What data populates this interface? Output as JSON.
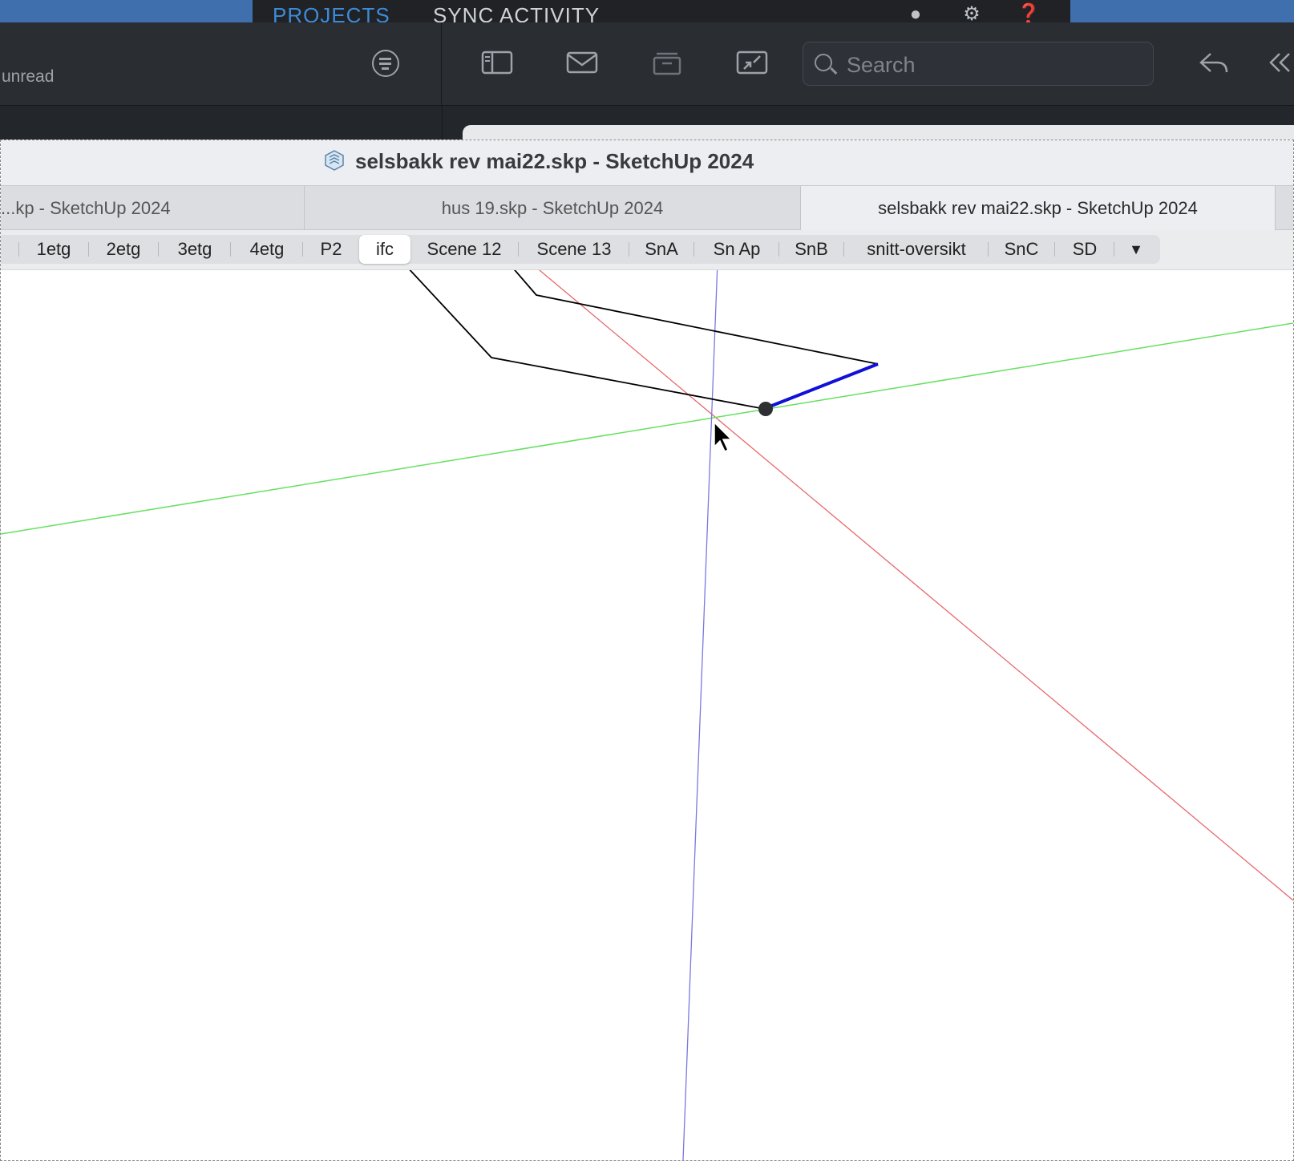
{
  "background_app": {
    "tabs": [
      "PROJECTS",
      "SYNC ACTIVITY"
    ],
    "icons": [
      "user-icon",
      "gear-icon",
      "help-icon"
    ],
    "accent": "#3d8bd8"
  },
  "mail": {
    "unread_label": "unread",
    "search_placeholder": "Search",
    "toolbar_icons": [
      "filter-icon",
      "sidebar-icon",
      "envelope-icon",
      "archive-icon",
      "collapse-icon",
      "reply-icon",
      "back-double-icon"
    ]
  },
  "sketchup": {
    "window_title": "selsbakk rev mai22.skp - SketchUp 2024",
    "doc_tabs": [
      {
        "label": "...kp - SketchUp 2024",
        "active": false
      },
      {
        "label": "hus 19.skp - SketchUp 2024",
        "active": false
      },
      {
        "label": "selsbakk rev mai22.skp - SketchUp 2024",
        "active": true
      }
    ],
    "scenes": [
      {
        "label": "1etg",
        "active": false
      },
      {
        "label": "2etg",
        "active": false
      },
      {
        "label": "3etg",
        "active": false
      },
      {
        "label": "4etg",
        "active": false
      },
      {
        "label": "P2",
        "active": false
      },
      {
        "label": "ifc",
        "active": true
      },
      {
        "label": "Scene 12",
        "active": false
      },
      {
        "label": "Scene 13",
        "active": false
      },
      {
        "label": "SnA",
        "active": false
      },
      {
        "label": "Sn Ap",
        "active": false
      },
      {
        "label": "SnB",
        "active": false
      },
      {
        "label": "snitt-oversikt",
        "active": false
      },
      {
        "label": "SnC",
        "active": false
      },
      {
        "label": "SD",
        "active": false
      }
    ],
    "scene_more_glyph": "▼",
    "axis_colors": {
      "red": "#e8686c",
      "green": "#66e060",
      "blue": "#7b78e0"
    },
    "edge_color": "#000000",
    "selected_edge_color": "#1010d8"
  }
}
